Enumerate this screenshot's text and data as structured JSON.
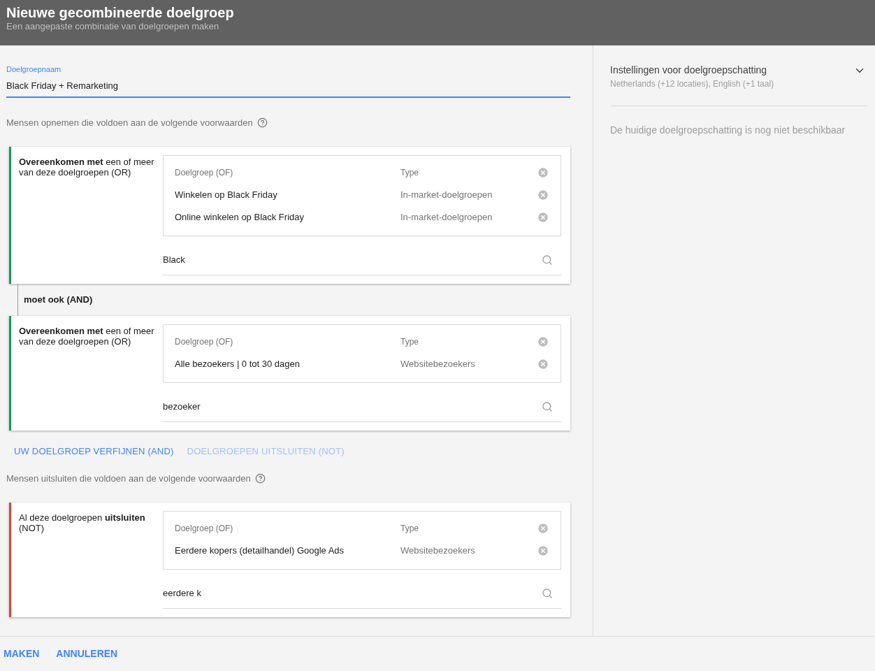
{
  "header": {
    "title": "Nieuwe gecombineerde doelgroep",
    "subtitle": "Een aangepaste combinatie van doelgroepen maken"
  },
  "name_field": {
    "label": "Doelgroepnaam",
    "value": "Black Friday + Remarketing"
  },
  "include_section": {
    "heading": "Mensen opnemen die voldoen aan de volgende voorwaarden",
    "groups": [
      {
        "kind": "include",
        "description": "**Overeenkomen met** een of meer van deze doelgroepen (OR)",
        "columns": [
          "Doelgroep (OF)",
          "Type"
        ],
        "rows": [
          {
            "audience": "Winkelen op Black Friday",
            "type": "In-market-doelgroepen"
          },
          {
            "audience": "Online winkelen op Black Friday",
            "type": "In-market-doelgroepen"
          }
        ],
        "search": "Black",
        "connector": "moet ook (AND)"
      },
      {
        "kind": "include",
        "description": "**Overeenkomen met** een of meer van deze doelgroepen (OR)",
        "columns": [
          "Doelgroep (OF)",
          "Type"
        ],
        "rows": [
          {
            "audience": "Alle bezoekers | 0 tot 30 dagen",
            "type": "Websitebezoekers"
          }
        ],
        "search": "bezoeker"
      }
    ]
  },
  "actions": [
    {
      "label": "UW DOELGROEP VERFIJNEN (AND)",
      "disabled": false
    },
    {
      "label": "DOELGROEPEN UITSLUITEN (NOT)",
      "disabled": true
    }
  ],
  "exclude_section": {
    "heading": "Mensen uitsluiten die voldoen aan de volgende voorwaarden",
    "groups": [
      {
        "kind": "exclude",
        "description": "Al deze doelgroepen **uitsluiten** (NOT)",
        "columns": [
          "Doelgroep (OF)",
          "Type"
        ],
        "rows": [
          {
            "audience": "Eerdere kopers (detailhandel) Google Ads",
            "type": "Websitebezoekers"
          }
        ],
        "search": "eerdere k"
      }
    ]
  },
  "estimate_panel": {
    "title": "Instellingen voor doelgroepschatting",
    "subtitle": "Netherlands (+12 locaties), English (+1 taal)",
    "expanded": false,
    "message": "De huidige doelgroepschatting is nog niet beschikbaar"
  },
  "footer": {
    "buttons": [
      "MAKEN",
      "ANNULEREN"
    ]
  }
}
